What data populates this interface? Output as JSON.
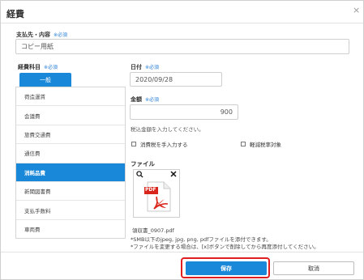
{
  "dialog": {
    "title": "経費",
    "close_label": "×"
  },
  "payee": {
    "label": "支払先・内容",
    "required": "※必須",
    "value": "コピー用紙"
  },
  "category": {
    "label": "経費科目",
    "required": "※必須",
    "tab": "一般",
    "items": [
      {
        "label": "荷造運賃",
        "active": false
      },
      {
        "label": "会議費",
        "active": false
      },
      {
        "label": "旅費交通費",
        "active": false
      },
      {
        "label": "通信費",
        "active": false
      },
      {
        "label": "消耗品費",
        "active": true
      },
      {
        "label": "新聞図書費",
        "active": false
      },
      {
        "label": "支払手数料",
        "active": false
      },
      {
        "label": "車両費",
        "active": false
      },
      {
        "label": "租税公課",
        "active": false
      }
    ]
  },
  "date": {
    "label": "日付",
    "required": "※必須",
    "value": "2020/09/28"
  },
  "amount": {
    "label": "金額",
    "required": "※必須",
    "value": "900",
    "help": "税込金額を入力してください。"
  },
  "options": {
    "manual_tax": "消費税を手入力する",
    "reduced_rate": "軽減税率対象"
  },
  "file": {
    "label": "ファイル",
    "name": "領収書_0907.pdf",
    "badge": "PDF",
    "zoom_icon": "magnifier-icon",
    "remove_icon": "close-icon",
    "note1": "*SMB以下のjpeg, jpg, png, pdfファイルを添付できます。",
    "note2": "*ファイルを変更する場合は、[x]ボタンで削除してから再度添付してください。"
  },
  "actions": {
    "save": "保存",
    "cancel": "取消"
  },
  "colors": {
    "accent": "#1a88d8",
    "highlight": "#e02020",
    "pdf_red": "#d9261c"
  }
}
